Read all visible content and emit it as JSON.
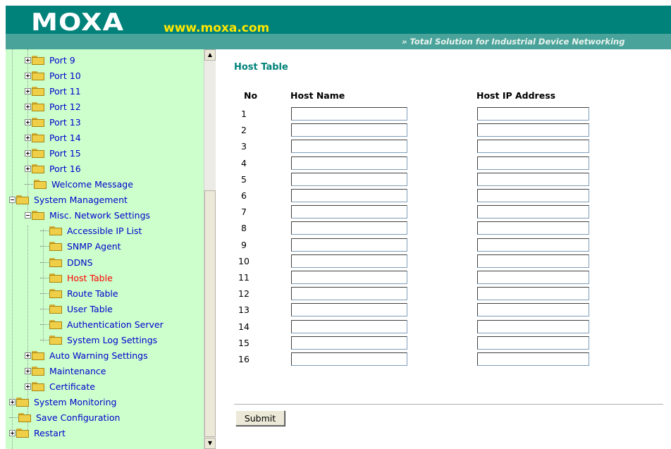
{
  "header": {
    "logo": "MOXA",
    "url": "www.moxa.com",
    "tagline": "»  Total Solution for Industrial Device Networking"
  },
  "tree": {
    "items": [
      {
        "label": "Port 9",
        "level": 2,
        "toggle": "plus",
        "icon": "folder-icon"
      },
      {
        "label": "Port 10",
        "level": 2,
        "toggle": "plus",
        "icon": "folder-icon"
      },
      {
        "label": "Port 11",
        "level": 2,
        "toggle": "plus",
        "icon": "folder-icon"
      },
      {
        "label": "Port 12",
        "level": 2,
        "toggle": "plus",
        "icon": "folder-icon"
      },
      {
        "label": "Port 13",
        "level": 2,
        "toggle": "plus",
        "icon": "folder-icon"
      },
      {
        "label": "Port 14",
        "level": 2,
        "toggle": "plus",
        "icon": "folder-icon"
      },
      {
        "label": "Port 15",
        "level": 2,
        "toggle": "plus",
        "icon": "folder-icon"
      },
      {
        "label": "Port 16",
        "level": 2,
        "toggle": "plus",
        "icon": "folder-icon"
      },
      {
        "label": "Welcome Message",
        "level": 2,
        "toggle": "none",
        "icon": "folder-icon"
      },
      {
        "label": "System Management",
        "level": 1,
        "toggle": "minus",
        "icon": "open-folder-icon"
      },
      {
        "label": "Misc. Network Settings",
        "level": 2,
        "toggle": "minus",
        "icon": "open-folder-icon"
      },
      {
        "label": "Accessible IP List",
        "level": 3,
        "toggle": "none",
        "icon": "folder-icon"
      },
      {
        "label": "SNMP Agent",
        "level": 3,
        "toggle": "none",
        "icon": "folder-icon"
      },
      {
        "label": "DDNS",
        "level": 3,
        "toggle": "none",
        "icon": "folder-icon"
      },
      {
        "label": "Host Table",
        "level": 3,
        "toggle": "none",
        "icon": "folder-icon",
        "selected": true
      },
      {
        "label": "Route Table",
        "level": 3,
        "toggle": "none",
        "icon": "folder-icon"
      },
      {
        "label": "User Table",
        "level": 3,
        "toggle": "none",
        "icon": "folder-icon"
      },
      {
        "label": "Authentication Server",
        "level": 3,
        "toggle": "none",
        "icon": "folder-icon"
      },
      {
        "label": "System Log Settings",
        "level": 3,
        "toggle": "none",
        "icon": "folder-icon"
      },
      {
        "label": "Auto Warning Settings",
        "level": 2,
        "toggle": "plus",
        "icon": "folder-icon"
      },
      {
        "label": "Maintenance",
        "level": 2,
        "toggle": "plus",
        "icon": "folder-icon"
      },
      {
        "label": "Certificate",
        "level": 2,
        "toggle": "plus",
        "icon": "folder-icon"
      },
      {
        "label": "System Monitoring",
        "level": 1,
        "toggle": "plus",
        "icon": "folder-icon"
      },
      {
        "label": "Save Configuration",
        "level": 1,
        "toggle": "none",
        "icon": "folder-icon"
      },
      {
        "label": "Restart",
        "level": 1,
        "toggle": "plus",
        "icon": "folder-icon"
      }
    ]
  },
  "scrollbar": {
    "up_icon": "scroll-up-arrow-icon",
    "down_icon": "scroll-down-arrow-icon"
  },
  "main": {
    "title": "Host Table",
    "columns": {
      "no": "No",
      "host_name": "Host Name",
      "host_ip": "Host IP Address"
    },
    "rows": [
      {
        "no": "1",
        "host_name": "",
        "host_ip": ""
      },
      {
        "no": "2",
        "host_name": "",
        "host_ip": ""
      },
      {
        "no": "3",
        "host_name": "",
        "host_ip": ""
      },
      {
        "no": "4",
        "host_name": "",
        "host_ip": ""
      },
      {
        "no": "5",
        "host_name": "",
        "host_ip": ""
      },
      {
        "no": "6",
        "host_name": "",
        "host_ip": ""
      },
      {
        "no": "7",
        "host_name": "",
        "host_ip": ""
      },
      {
        "no": "8",
        "host_name": "",
        "host_ip": ""
      },
      {
        "no": "9",
        "host_name": "",
        "host_ip": ""
      },
      {
        "no": "10",
        "host_name": "",
        "host_ip": ""
      },
      {
        "no": "11",
        "host_name": "",
        "host_ip": ""
      },
      {
        "no": "12",
        "host_name": "",
        "host_ip": ""
      },
      {
        "no": "13",
        "host_name": "",
        "host_ip": ""
      },
      {
        "no": "14",
        "host_name": "",
        "host_ip": ""
      },
      {
        "no": "15",
        "host_name": "",
        "host_ip": ""
      },
      {
        "no": "16",
        "host_name": "",
        "host_ip": ""
      }
    ],
    "submit_label": "Submit"
  },
  "colors": {
    "brand_teal": "#00827a",
    "url_yellow": "#ffe600",
    "tree_background": "#ccffcc",
    "link_blue": "#0000cc",
    "selected_red": "#ff0000"
  }
}
